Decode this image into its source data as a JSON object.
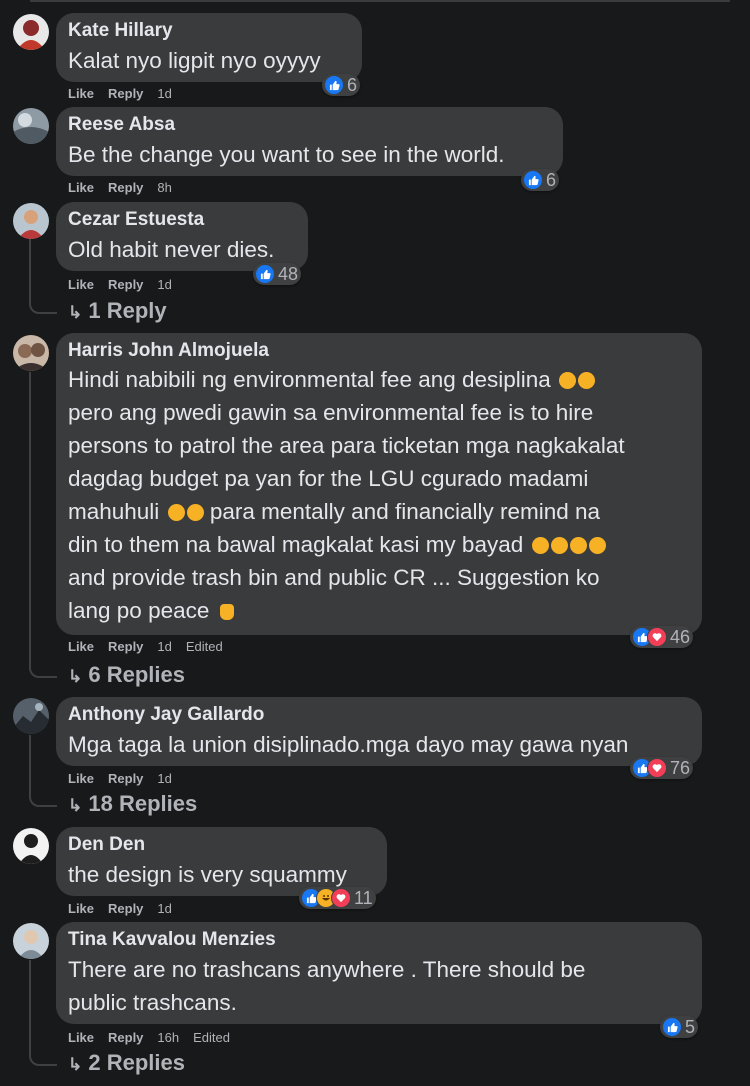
{
  "comments": [
    {
      "author": "Kate Hillary",
      "text": "Kalat nyo ligpit nyo oyyyy",
      "like": "Like",
      "reply": "Reply",
      "time": "1d",
      "reactions": "6"
    },
    {
      "author": "Reese Absa",
      "text": "Be the change you want to see in the world.",
      "like": "Like",
      "reply": "Reply",
      "time": "8h",
      "reactions": "6"
    },
    {
      "author": "Cezar Estuesta",
      "text": "Old habit never dies.",
      "like": "Like",
      "reply": "Reply",
      "time": "1d",
      "reactions": "48",
      "replies": "1 Reply"
    },
    {
      "author": "Harris John Almojuela",
      "lines": [
        "Hindi nabibili ng environmental fee ang desiplina",
        "pero ang pwedi gawin sa environmental fee is to hire",
        "persons to patrol the area para ticketan mga nagkakalat",
        "dagdag budget pa yan for the LGU cgurado madami",
        "mahuhuli",
        "para mentally and financially remind na",
        "din to them na bawal magkalat kasi my bayad",
        "and provide trash bin and public CR ... Suggestion ko",
        "lang po peace"
      ],
      "like": "Like",
      "reply": "Reply",
      "time": "1d",
      "edited": "Edited",
      "reactions": "46",
      "replies": "6 Replies"
    },
    {
      "author": "Anthony Jay Gallardo",
      "text": "Mga taga la union disiplinado.mga dayo may gawa nyan",
      "like": "Like",
      "reply": "Reply",
      "time": "1d",
      "reactions": "76",
      "replies": "18 Replies"
    },
    {
      "author": "Den Den",
      "text": "the design is very squammy",
      "like": "Like",
      "reply": "Reply",
      "time": "1d",
      "reactions": "11"
    },
    {
      "author": "Tina Kavvalou Menzies",
      "lines": [
        "There are no trashcans anywhere . There should be",
        "public trashcans."
      ],
      "like": "Like",
      "reply": "Reply",
      "time": "16h",
      "edited": "Edited",
      "reactions": "5",
      "replies": "2 Replies"
    }
  ],
  "icons": {
    "like": "like-reaction-icon",
    "love": "love-reaction-icon",
    "haha": "haha-reaction-icon",
    "reply_arrow": "reply-arrow-icon"
  },
  "colors": {
    "background": "#18191a",
    "bubble": "#3a3b3c",
    "like": "#1877f2",
    "love": "#f33e58",
    "haha": "#f7b125",
    "muted": "#b0b3b8"
  }
}
